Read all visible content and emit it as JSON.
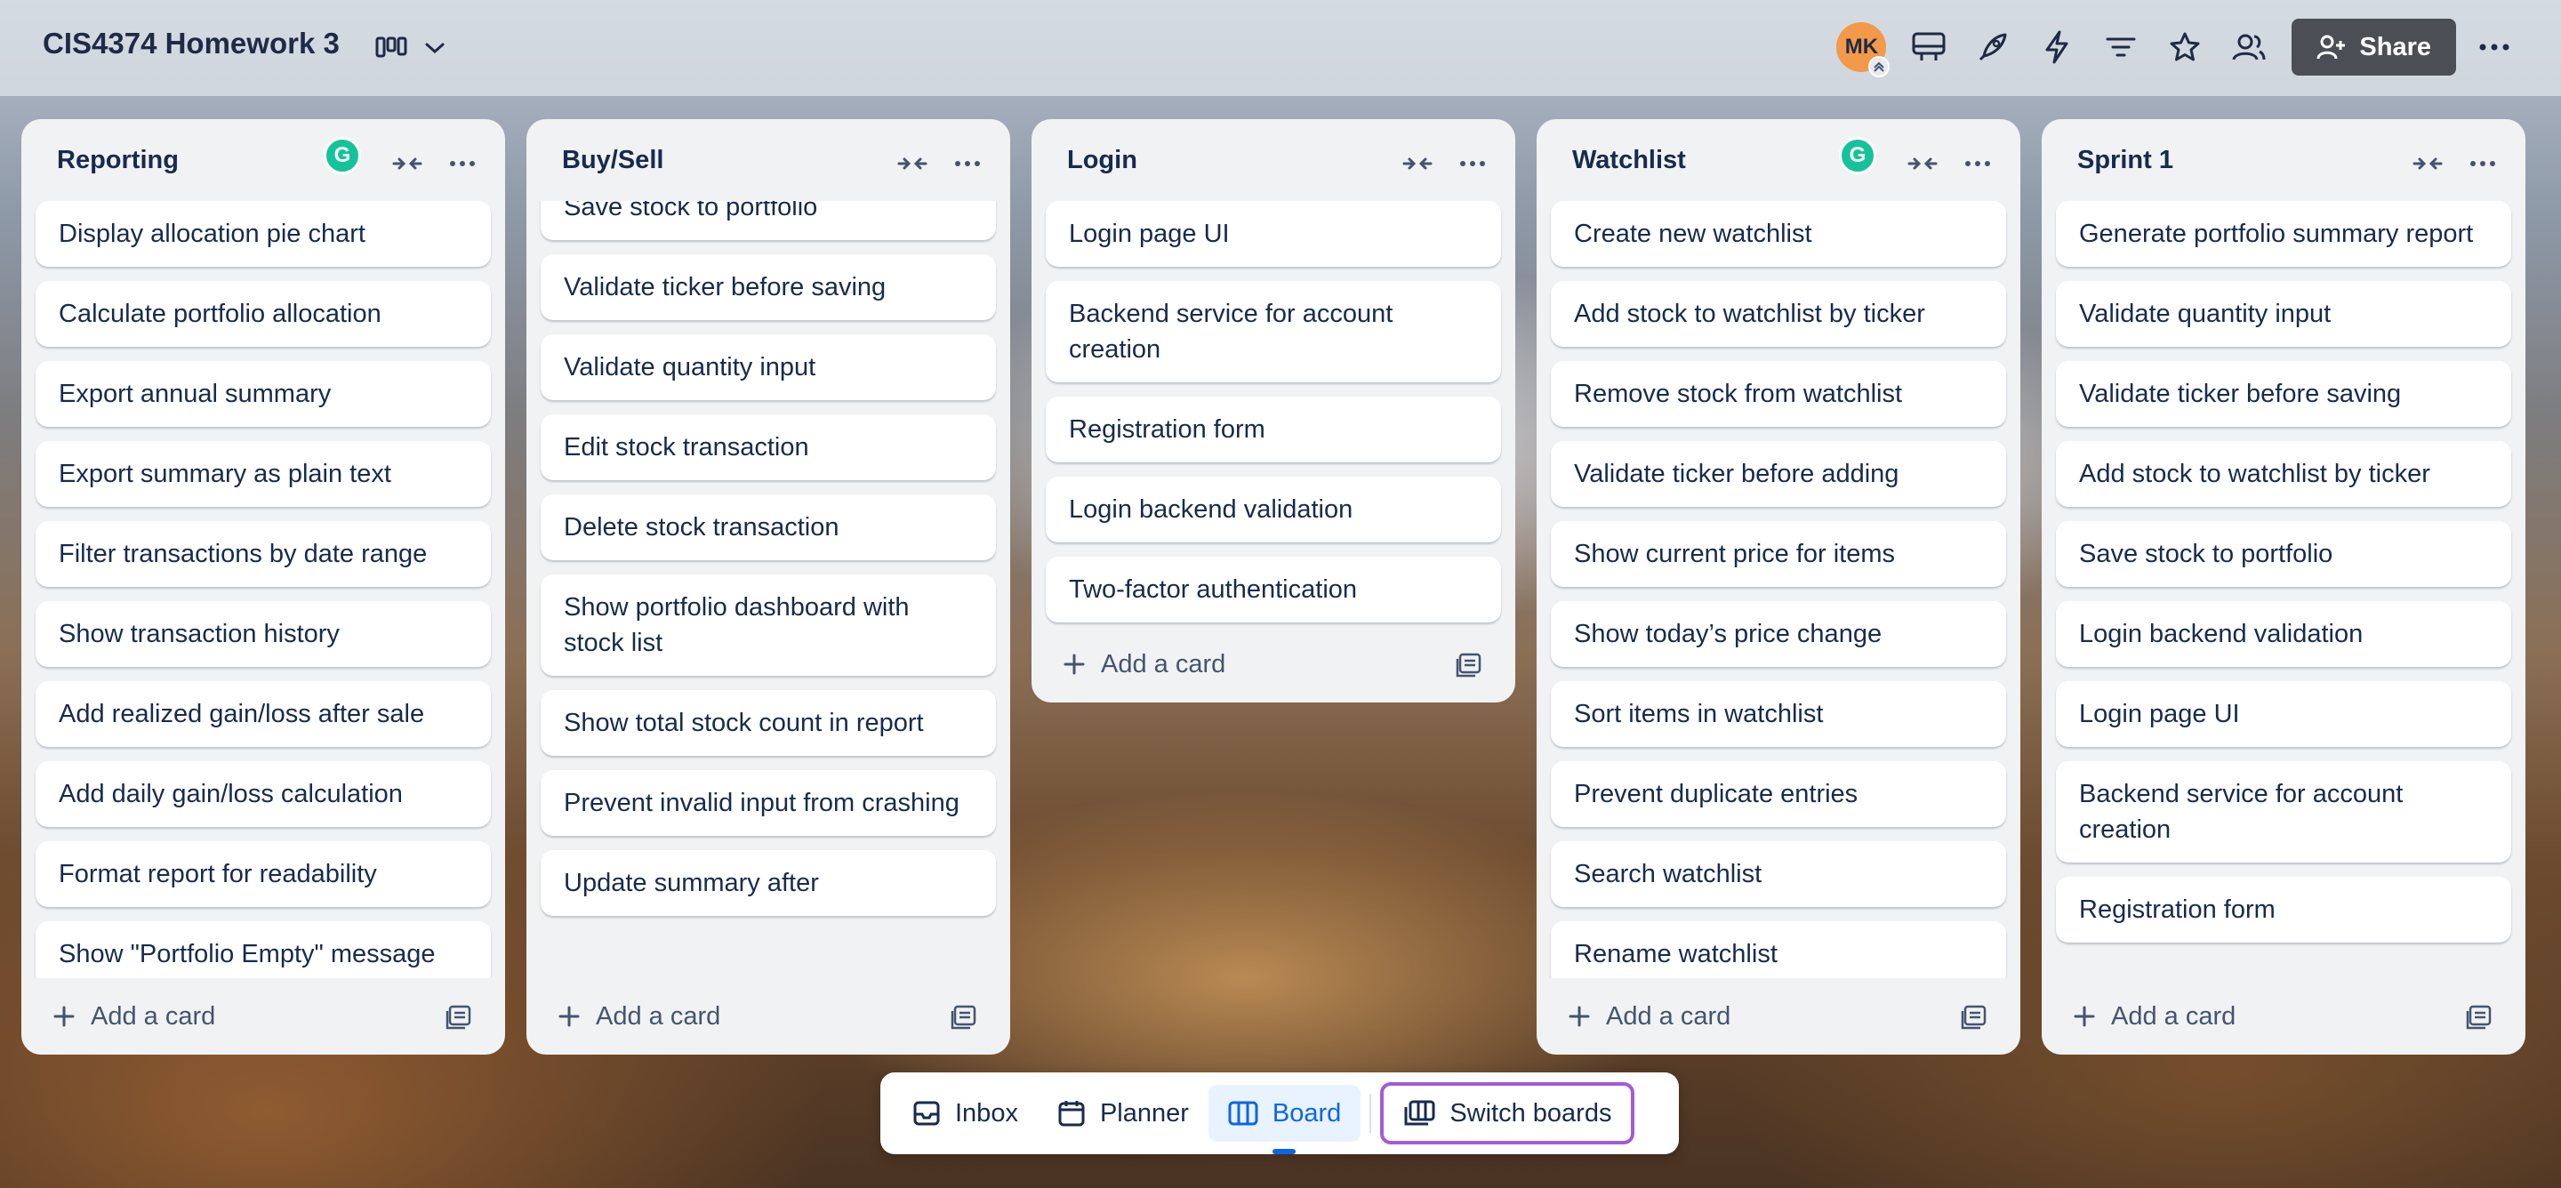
{
  "header": {
    "title": "CIS4374 Homework 3",
    "avatar_initials": "MK",
    "share_label": "Share"
  },
  "lists": [
    {
      "title": "Reporting",
      "grammarly": true,
      "cards": [
        "Display allocation pie chart",
        "Calculate portfolio allocation",
        "Export annual summary",
        "Export summary as plain text",
        "Filter transactions by date range",
        "Show transaction history",
        "Add realized gain/loss after sale",
        "Add daily gain/loss calculation",
        "Format report for readability",
        "Show \"Portfolio Empty\" message"
      ],
      "add_label": "Add a card"
    },
    {
      "title": "Buy/Sell",
      "grammarly": false,
      "cards": [
        "Save stock to portfolio",
        "Validate ticker before saving",
        "Validate quantity input",
        "Edit stock transaction",
        "Delete stock transaction",
        "Show portfolio dashboard with stock list",
        "Show total stock count in report",
        "Prevent invalid input from crashing",
        "Update summary after"
      ],
      "add_label": "Add a card"
    },
    {
      "title": "Login",
      "grammarly": false,
      "cards": [
        "Login page UI",
        "Backend service for account creation",
        "Registration form",
        "Login backend validation",
        "Two-factor authentication"
      ],
      "add_label": "Add a card"
    },
    {
      "title": "Watchlist",
      "grammarly": true,
      "cards": [
        "Create new watchlist",
        "Add stock to watchlist by ticker",
        "Remove stock from watchlist",
        "Validate ticker before adding",
        "Show current price for items",
        "Show today’s price change",
        "Sort items in watchlist",
        "Prevent duplicate entries",
        "Search watchlist",
        "Rename watchlist"
      ],
      "add_label": "Add a card"
    },
    {
      "title": "Sprint 1",
      "grammarly": false,
      "cards": [
        "Generate portfolio summary report",
        "Validate quantity input",
        "Validate ticker before saving",
        "Add stock to watchlist by ticker",
        "Save stock to portfolio",
        "Login backend validation",
        "Login page UI",
        "Backend service for account creation",
        "Registration form"
      ],
      "add_label": "Add a card"
    }
  ],
  "bottom_nav": {
    "inbox": "Inbox",
    "planner": "Planner",
    "board": "Board",
    "switch": "Switch boards",
    "active": "board"
  },
  "colors": {
    "accent": "#0c66e4",
    "avatar": "#f2994a",
    "grammarly": "#15c39a",
    "switch_outline": "#a35bd6"
  }
}
